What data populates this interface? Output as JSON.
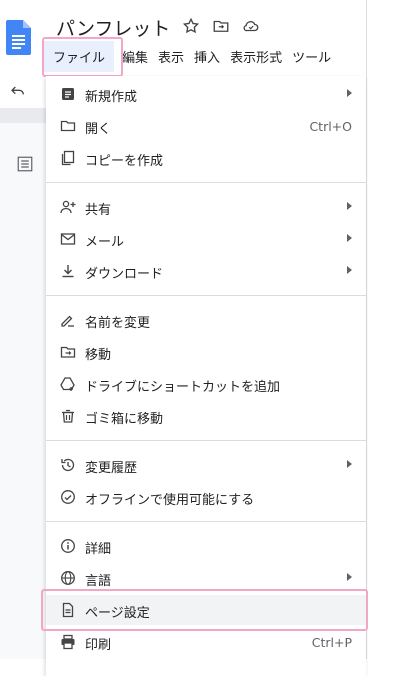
{
  "document": {
    "title": "パンフレット"
  },
  "menubar": {
    "items": [
      "ファイル",
      "編集",
      "表示",
      "挿入",
      "表示形式",
      "ツール"
    ]
  },
  "file_menu": {
    "new": "新規作成",
    "open": "開く",
    "open_shortcut": "Ctrl+O",
    "copy": "コピーを作成",
    "share": "共有",
    "email": "メール",
    "download": "ダウンロード",
    "rename": "名前を変更",
    "move": "移動",
    "add_shortcut": "ドライブにショートカットを追加",
    "trash": "ゴミ箱に移動",
    "history": "変更履歴",
    "offline": "オフラインで使用可能にする",
    "details": "詳細",
    "language": "言語",
    "page_setup": "ページ設定",
    "print": "印刷",
    "print_shortcut": "Ctrl+P"
  },
  "colors": {
    "accent_highlight": "#f4a6c6",
    "active_menu_bg": "#e8f0fe",
    "docs_blue": "#4285f4"
  }
}
